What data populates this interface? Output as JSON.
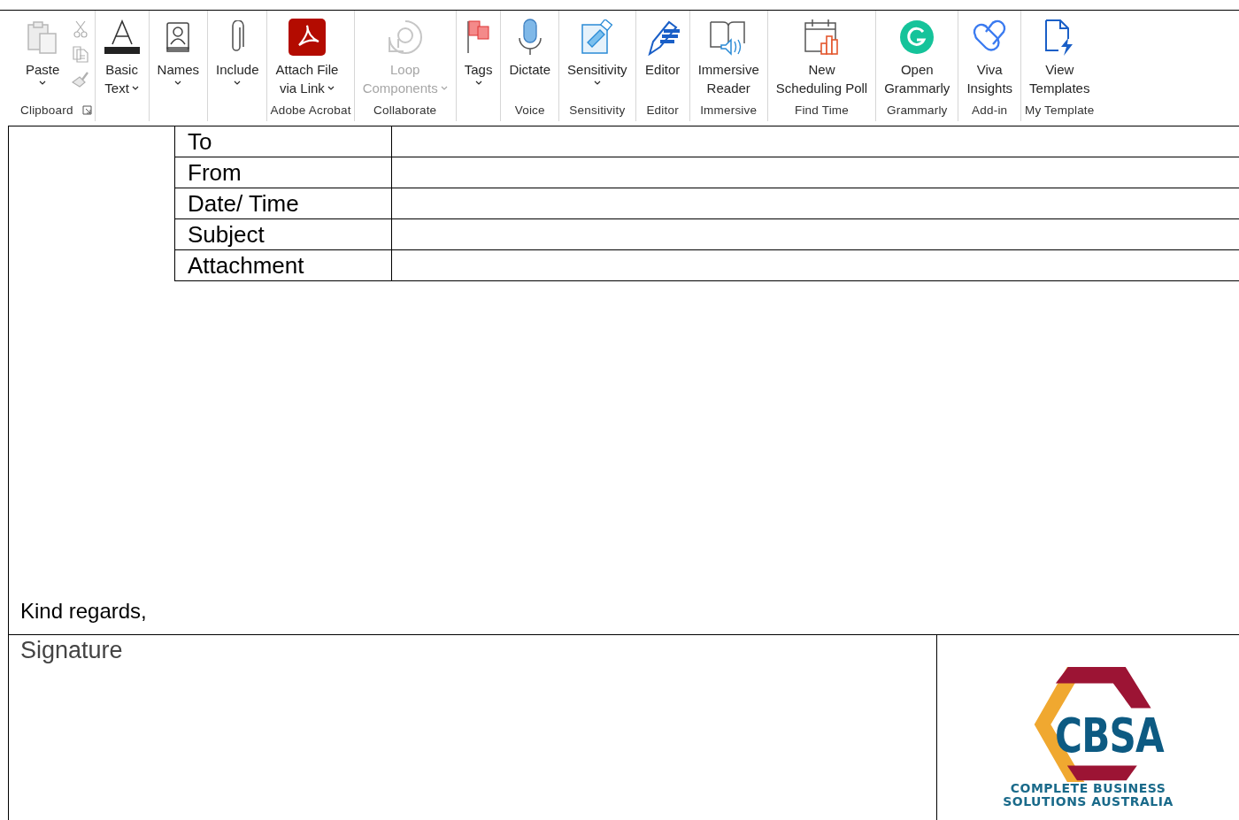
{
  "ribbon": {
    "groups": [
      {
        "label": "Clipboard",
        "launcher": true,
        "buttons": [
          {
            "kind": "paste",
            "lines": [
              "Paste"
            ],
            "dropdown": true,
            "disabled": false
          }
        ],
        "small_buttons": [
          {
            "kind": "cut",
            "disabled": true
          },
          {
            "kind": "copy",
            "disabled": true
          },
          {
            "kind": "painter",
            "disabled": true
          }
        ]
      },
      {
        "buttons": [
          {
            "kind": "basic-text",
            "lines": [
              "Basic",
              "Text"
            ],
            "dropdown": true,
            "disabled": false
          }
        ]
      },
      {
        "buttons": [
          {
            "kind": "names",
            "lines": [
              "Names"
            ],
            "dropdown": true,
            "disabled": false
          }
        ]
      },
      {
        "buttons": [
          {
            "kind": "include",
            "lines": [
              "Include"
            ],
            "dropdown": true,
            "disabled": false
          }
        ]
      },
      {
        "label": "Adobe Acrobat",
        "buttons": [
          {
            "kind": "acrobat",
            "lines": [
              "Attach File",
              "via Link"
            ],
            "dropdown": true,
            "disabled": false
          }
        ]
      },
      {
        "label": "Collaborate",
        "buttons": [
          {
            "kind": "loop",
            "lines": [
              "Loop",
              "Components"
            ],
            "dropdown": true,
            "disabled": true
          }
        ]
      },
      {
        "buttons": [
          {
            "kind": "tags",
            "lines": [
              "Tags"
            ],
            "dropdown": true,
            "disabled": false
          }
        ]
      },
      {
        "label": "Voice",
        "buttons": [
          {
            "kind": "dictate",
            "lines": [
              "Dictate"
            ],
            "dropdown": false,
            "disabled": false
          }
        ]
      },
      {
        "label": "Sensitivity",
        "buttons": [
          {
            "kind": "sensitivity",
            "lines": [
              "Sensitivity"
            ],
            "dropdown": true,
            "disabled": false
          }
        ]
      },
      {
        "label": "Editor",
        "buttons": [
          {
            "kind": "editor",
            "lines": [
              "Editor"
            ],
            "dropdown": false,
            "disabled": false
          }
        ]
      },
      {
        "label": "Immersive",
        "buttons": [
          {
            "kind": "immersive",
            "lines": [
              "Immersive",
              "Reader"
            ],
            "dropdown": false,
            "disabled": false
          }
        ]
      },
      {
        "label": "Find Time",
        "buttons": [
          {
            "kind": "poll",
            "lines": [
              "New",
              "Scheduling Poll"
            ],
            "dropdown": false,
            "disabled": false
          }
        ]
      },
      {
        "label": "Grammarly",
        "buttons": [
          {
            "kind": "grammarly",
            "lines": [
              "Open",
              "Grammarly"
            ],
            "dropdown": false,
            "disabled": false
          }
        ]
      },
      {
        "label": "Add-in",
        "buttons": [
          {
            "kind": "viva",
            "lines": [
              "Viva",
              "Insights"
            ],
            "dropdown": false,
            "disabled": false
          }
        ]
      },
      {
        "label": "My Template",
        "buttons": [
          {
            "kind": "templates",
            "lines": [
              "View",
              "Templates"
            ],
            "dropdown": false,
            "disabled": false
          }
        ]
      }
    ]
  },
  "header_table": {
    "rows": [
      {
        "label": "To"
      },
      {
        "label": "From"
      },
      {
        "label": "Date/ Time"
      },
      {
        "label": "Subject"
      },
      {
        "label": "Attachment"
      }
    ]
  },
  "body": {
    "closing": "Kind regards,"
  },
  "signature": {
    "label": "Signature",
    "logo": {
      "mark": "CBSA",
      "lines": [
        "COMPLETE BUSINESS",
        "SOLUTIONS AUSTRALIA"
      ]
    }
  }
}
